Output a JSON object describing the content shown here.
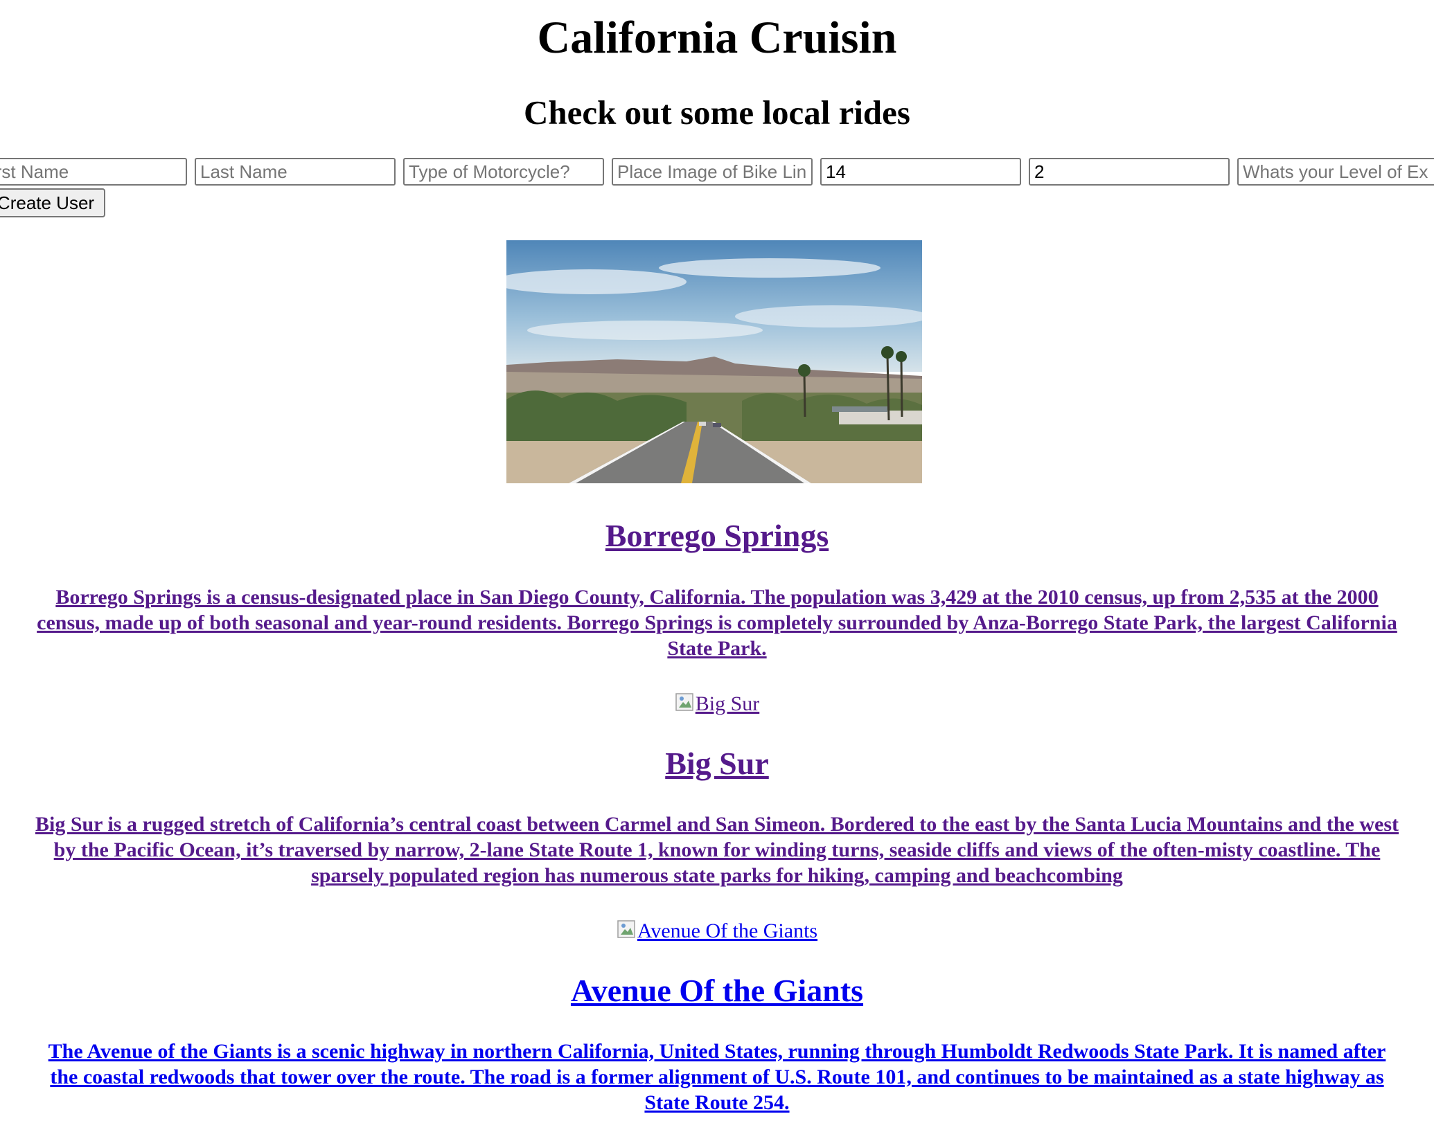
{
  "header": {
    "title": "California Cruisin",
    "subtitle": "Check out some local rides"
  },
  "form": {
    "first_name": {
      "placeholder": "First Name",
      "shown": "irst Name"
    },
    "last_name": {
      "placeholder": "Last Name"
    },
    "motorcycle_type": {
      "placeholder": "Type of Motorcycle?"
    },
    "bike_image": {
      "placeholder": "Place Image of Bike Lin"
    },
    "field5": {
      "value": "14"
    },
    "field6": {
      "value": "2"
    },
    "experience": {
      "placeholder": "Whats your Level of Ex"
    },
    "submit_label": "Create User",
    "submit_shown": "Create User"
  },
  "rides": [
    {
      "title": "Borrego Springs",
      "description": "Borrego Springs is a census-designated place in San Diego County, California. The population was 3,429 at the 2010 census, up from 2,535 at the 2000 census, made up of both seasonal and year-round residents. Borrego Springs is completely surrounded by Anza-Borrego State Park, the largest California State Park."
    },
    {
      "image_alt": "Big Sur",
      "title": "Big Sur",
      "description": "Big Sur is a rugged stretch of California’s central coast between Carmel and San Simeon. Bordered to the east by the Santa Lucia Mountains and the west by the Pacific Ocean, it’s traversed by narrow, 2-lane State Route 1, known for winding turns, seaside cliffs and views of the often-misty coastline. The sparsely populated region has numerous state parks for hiking, camping and beachcombing"
    },
    {
      "image_alt": "Avenue Of the Giants",
      "title": "Avenue Of the Giants",
      "description": "The Avenue of the Giants is a scenic highway in northern California, United States, running through Humboldt Redwoods State Park. It is named after the coastal redwoods that tower over the route. The road is a former alignment of U.S. Route 101, and continues to be maintained as a state highway as State Route 254."
    }
  ],
  "colors": {
    "visited_link": "#551a8b",
    "link": "#0000ee"
  }
}
